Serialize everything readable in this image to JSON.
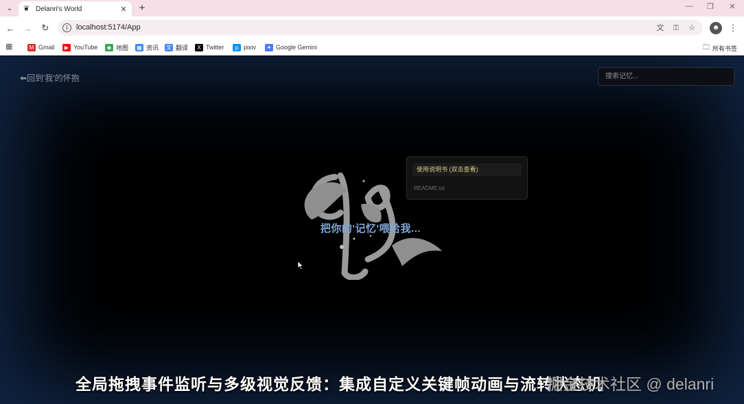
{
  "browser": {
    "tab": {
      "title": "Delanri's World"
    },
    "url": "localhost:5174/App",
    "bookmarks": [
      {
        "label": "Gmail",
        "icon": "gmail-icon",
        "color": "#d93025"
      },
      {
        "label": "YouTube",
        "icon": "youtube-icon",
        "color": "#ff0000"
      },
      {
        "label": "地图",
        "icon": "maps-icon",
        "color": "#34a853"
      },
      {
        "label": "资讯",
        "icon": "news-icon",
        "color": "#4285f4"
      },
      {
        "label": "翻译",
        "icon": "translate-icon",
        "color": "#4285f4"
      },
      {
        "label": "Twitter",
        "icon": "x-icon",
        "color": "#000000"
      },
      {
        "label": "pixiv",
        "icon": "pixiv-icon",
        "color": "#0096fa"
      },
      {
        "label": "Google Gemini",
        "icon": "gemini-icon",
        "color": "#4e7cf6"
      }
    ],
    "all_bookmarks": "所有书签"
  },
  "page": {
    "back_link": "⬅回到'我'的怀抱",
    "search_placeholder": "搜索记忆...",
    "drop_text": "把你的'记忆'喂给我...",
    "file_panel": {
      "item_label": "使用说明书 (双击查看)",
      "file_name": "README.txt"
    },
    "accent_color": "#7ea6d6"
  },
  "overlay": {
    "caption": "全局拖拽事件监听与多级视觉反馈：集成自定义关键帧动画与流转状态机",
    "watermark": "掘金技术社区 @ delanri"
  }
}
